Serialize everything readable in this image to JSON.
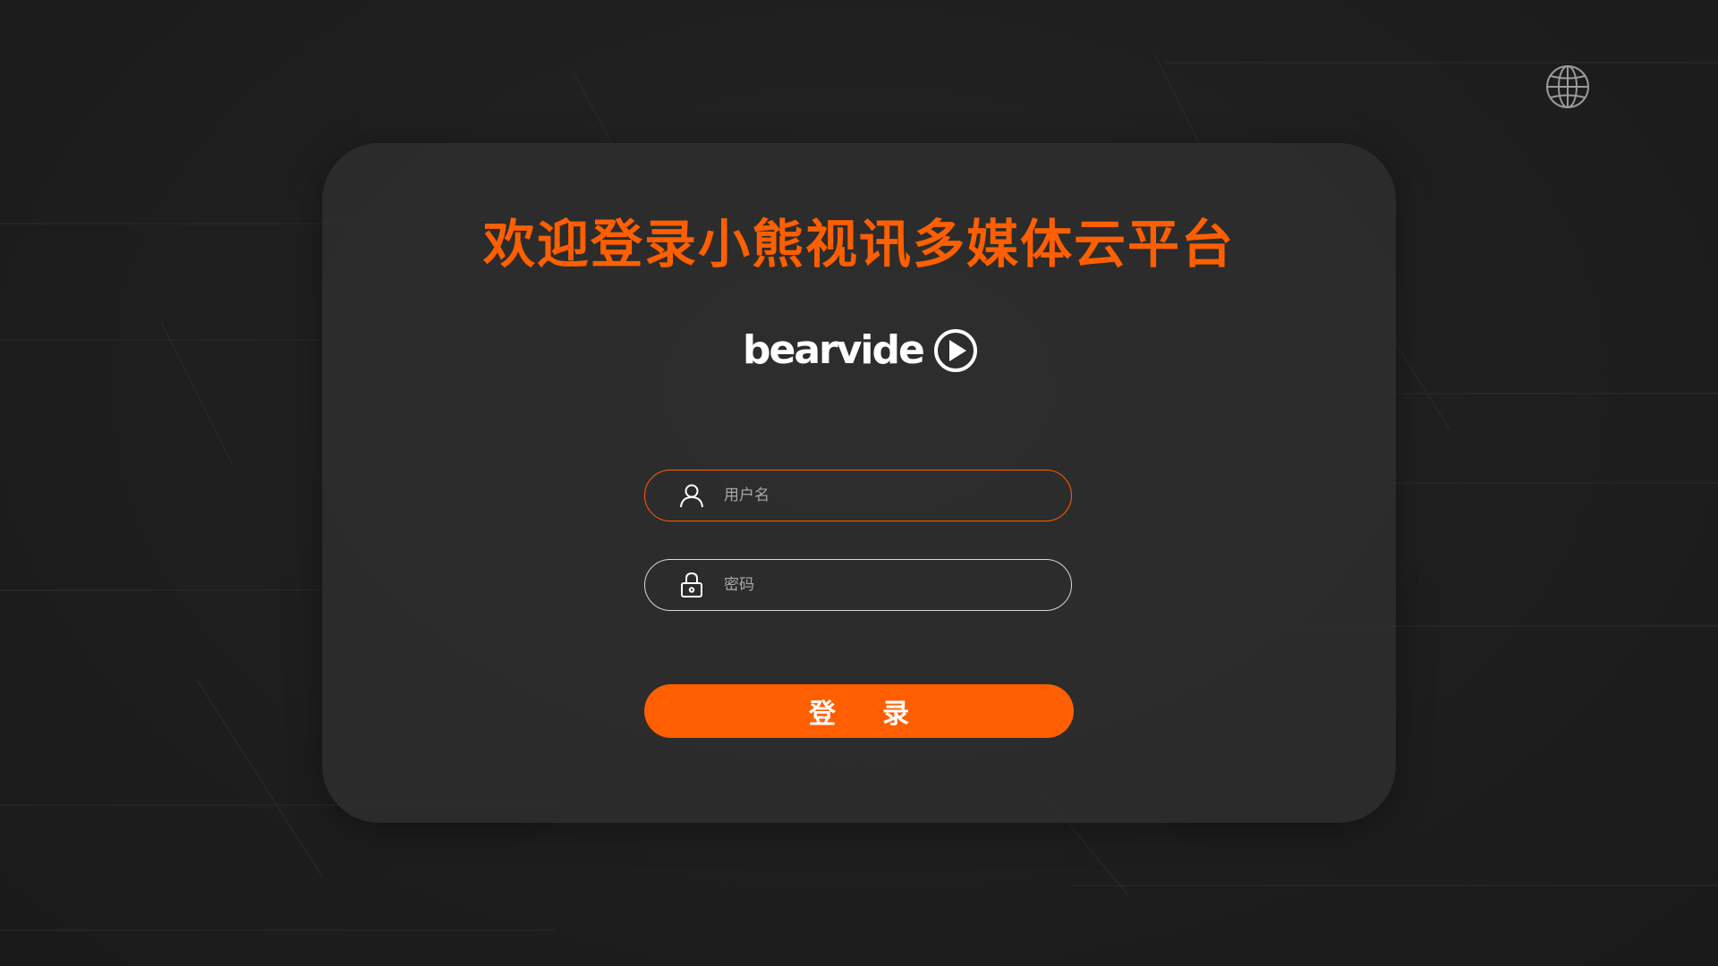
{
  "title": "欢迎登录小熊视讯多媒体云平台",
  "logo_text": "bearvideo",
  "username_field": {
    "placeholder": "用户名",
    "value": ""
  },
  "password_field": {
    "placeholder": "密码",
    "value": ""
  },
  "login_button": {
    "label": "登 录"
  },
  "colors": {
    "accent": "#ff5f00",
    "background": "#1f1f1f",
    "card": "#303030",
    "text": "#ffffff",
    "placeholder": "#a8a8a8"
  },
  "icons": {
    "language": "globe-icon",
    "username": "user-icon",
    "password": "lock-icon"
  }
}
